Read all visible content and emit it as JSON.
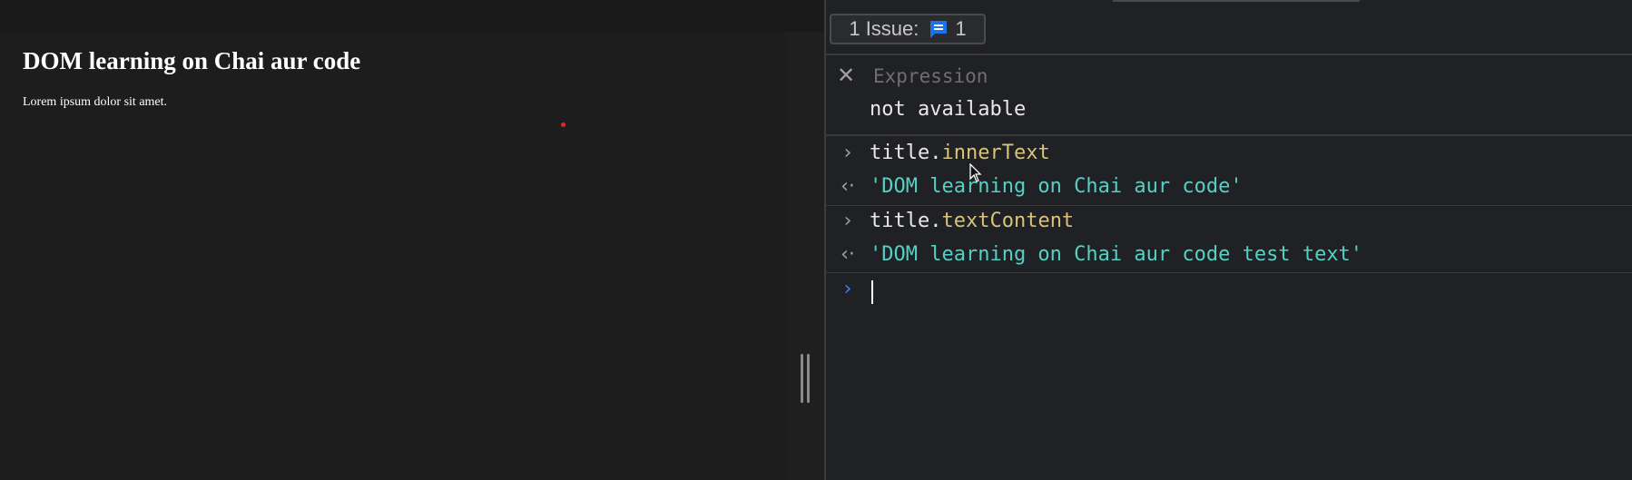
{
  "page": {
    "title": "DOM learning on Chai aur code",
    "paragraph": "Lorem ipsum dolor sit amet."
  },
  "devtools": {
    "issues": {
      "label": "1 Issue:",
      "icon": "chat-message-icon",
      "count": "1"
    },
    "live_expression": {
      "placeholder": "Expression",
      "result": "not available"
    },
    "console": {
      "entries": [
        {
          "input_object": "title.",
          "input_property": "innerText",
          "output": "'DOM learning on Chai aur code'"
        },
        {
          "input_object": "title.",
          "input_property": "textContent",
          "output": "'DOM learning on Chai aur code test text'"
        }
      ],
      "prompt_value": ""
    }
  },
  "colors": {
    "page_background": "#1d1d1e",
    "devtools_background": "#202124",
    "property_color": "#d9c27a",
    "string_color": "#55d0c4",
    "issue_icon_color": "#1a73e8",
    "active_prompt_color": "#3b82f6"
  }
}
